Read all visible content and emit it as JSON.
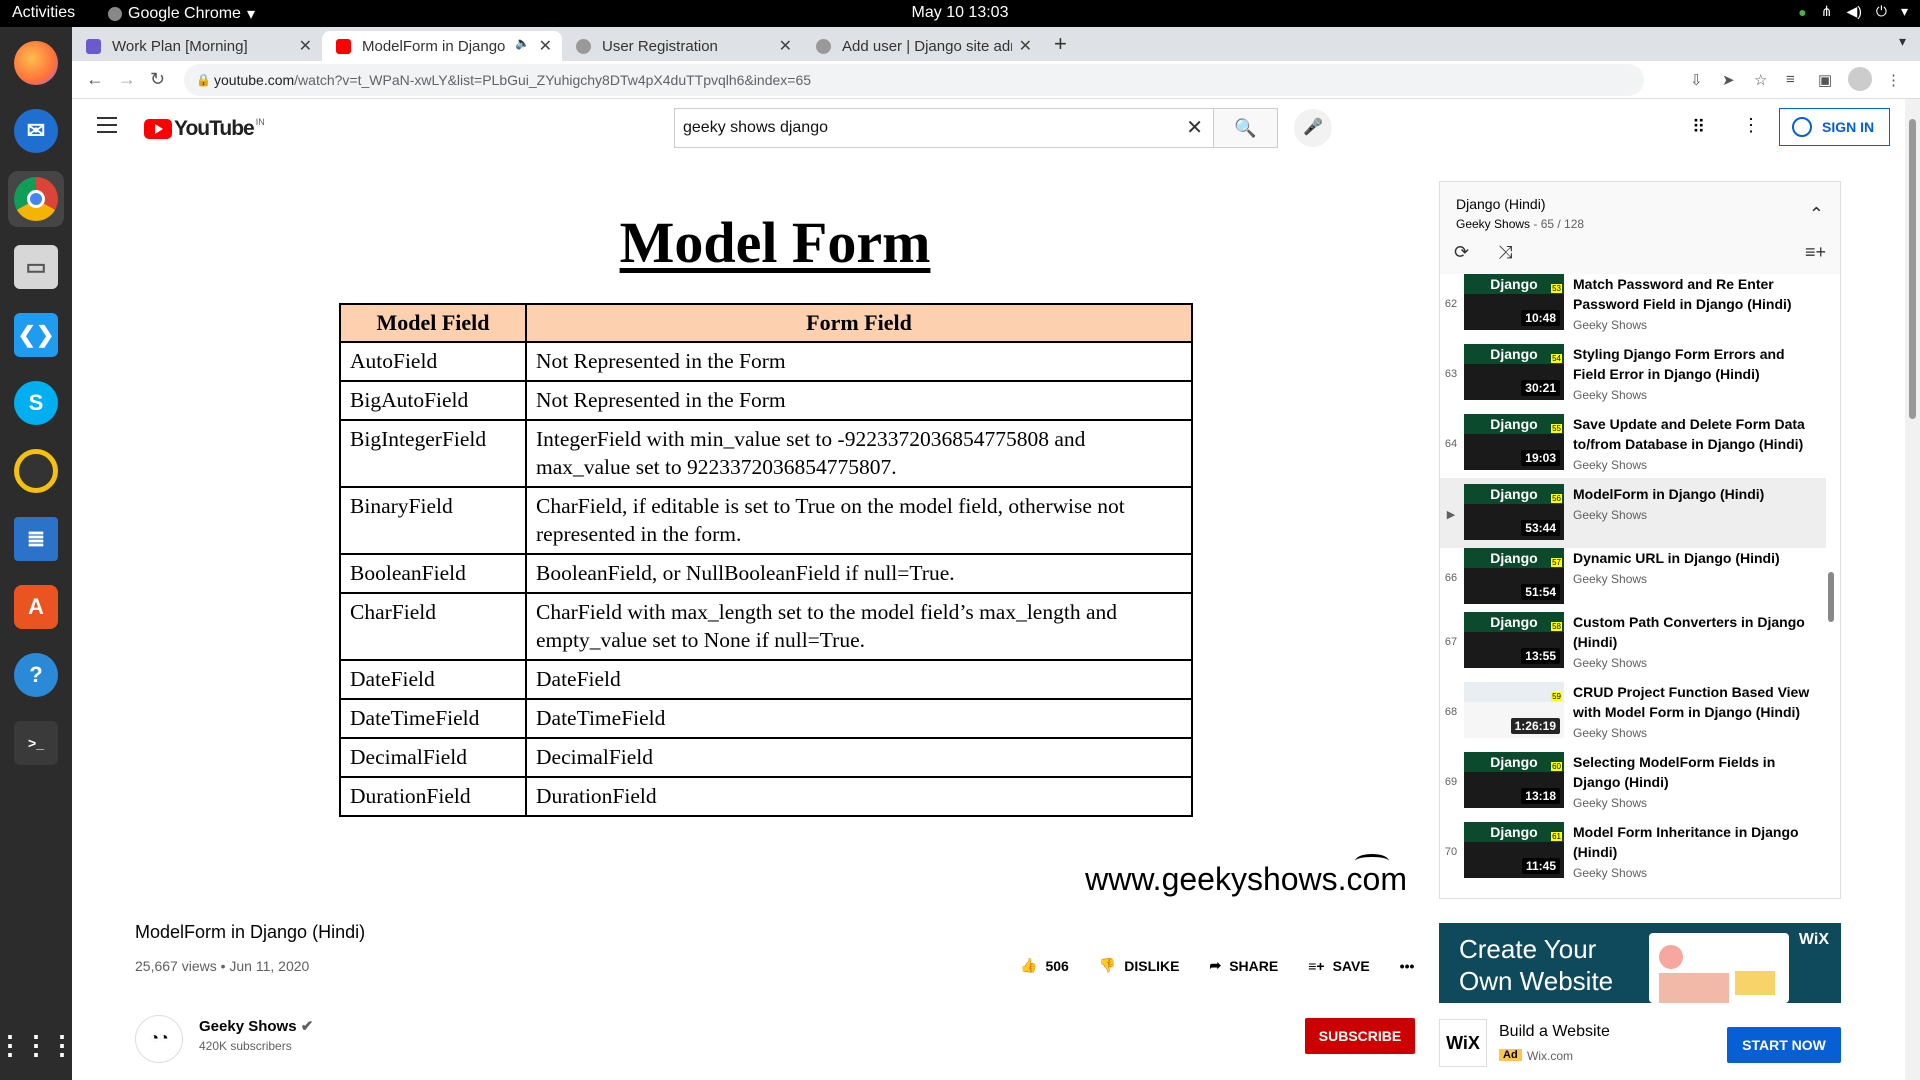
{
  "os": {
    "activities": "Activities",
    "app": "Google Chrome",
    "clock": "May 10  13:03"
  },
  "tabs": [
    {
      "label": "Work Plan [Morning]",
      "color": "#6a5acd"
    },
    {
      "label": "ModelForm in Django",
      "color": "#ff0000"
    },
    {
      "label": "User Registration",
      "color": "#999999"
    },
    {
      "label": "Add user | Django site adm",
      "color": "#999999"
    }
  ],
  "url": {
    "host": "youtube.com",
    "path": "/watch?v=t_WPaN-xwLY&list=PLbGui_ZYuhigchy8DTw4pX4duTTpvqlh6&index=65"
  },
  "yt": {
    "country": "IN",
    "search_value": "geeky shows django",
    "signin": "SIGN IN"
  },
  "slide": {
    "title": "Model Form",
    "headers": [
      "Model Field",
      "Form Field"
    ],
    "rows": [
      [
        "AutoField",
        "Not Represented in the Form"
      ],
      [
        "BigAutoField",
        "Not Represented in the Form"
      ],
      [
        "BigIntegerField",
        "IntegerField with min_value set to -9223372036854775808 and max_value set to 9223372036854775807."
      ],
      [
        "BinaryField",
        "CharField, if editable is set to True on the model field, otherwise not represented in the form."
      ],
      [
        "BooleanField",
        "BooleanField, or NullBooleanField if null=True."
      ],
      [
        "CharField",
        "CharField with max_length set to the model field’s max_length and empty_value set to None if null=True."
      ],
      [
        "DateField",
        "DateField"
      ],
      [
        "DateTimeField",
        "DateTimeField"
      ],
      [
        "DecimalField",
        "DecimalField"
      ],
      [
        "DurationField",
        "DurationField"
      ]
    ],
    "watermark": "www.geekyshows.com"
  },
  "video": {
    "title": "ModelForm in Django (Hindi)",
    "meta": "25,667 views • Jun 11, 2020",
    "likes": "506",
    "dislike": "DISLIKE",
    "share": "SHARE",
    "save": "SAVE"
  },
  "channel": {
    "name": "Geeky Shows",
    "subs": "420K subscribers",
    "subscribe": "SUBSCRIBE"
  },
  "playlist": {
    "title": "Django (Hindi)",
    "owner": "Geeky Shows",
    "position": " - 65 / 128",
    "items": [
      {
        "num": "62",
        "title": "Match Password and Re Enter Password Field in Django (Hindi)",
        "channel": "Geeky Shows",
        "duration": "10:48",
        "thumb": "Django",
        "badge": "53"
      },
      {
        "num": "63",
        "title": "Styling Django Form Errors and Field Error in Django (Hindi)",
        "channel": "Geeky Shows",
        "duration": "30:21",
        "thumb": "Django",
        "badge": "54"
      },
      {
        "num": "64",
        "title": "Save Update and Delete Form Data to/from Database in Django (Hindi)",
        "channel": "Geeky Shows",
        "duration": "19:03",
        "thumb": "Django",
        "badge": "55"
      },
      {
        "num": "▶",
        "title": "ModelForm in Django (Hindi)",
        "channel": "Geeky Shows",
        "duration": "53:44",
        "thumb": "Django",
        "badge": "56"
      },
      {
        "num": "66",
        "title": "Dynamic URL in Django (Hindi)",
        "channel": "Geeky Shows",
        "duration": "51:54",
        "thumb": "Django",
        "badge": "57"
      },
      {
        "num": "67",
        "title": "Custom Path Converters in Django (Hindi)",
        "channel": "Geeky Shows",
        "duration": "13:55",
        "thumb": "Django",
        "badge": "58"
      },
      {
        "num": "68",
        "title": "CRUD Project Function Based View with Model Form in Django (Hindi)",
        "channel": "Geeky Shows",
        "duration": "1:26:19",
        "thumb": "",
        "badge": "59"
      },
      {
        "num": "69",
        "title": "Selecting ModelForm Fields in Django (Hindi)",
        "channel": "Geeky Shows",
        "duration": "13:18",
        "thumb": "Django",
        "badge": "60"
      },
      {
        "num": "70",
        "title": "Model Form Inheritance in Django (Hindi)",
        "channel": "Geeky Shows",
        "duration": "11:45",
        "thumb": "Django",
        "badge": "61"
      }
    ]
  },
  "ad": {
    "headline": "Create Your Own Website",
    "brand": "WiX",
    "name": "Build a Website",
    "tag": "Ad",
    "domain": "Wix.com",
    "cta": "START NOW"
  }
}
